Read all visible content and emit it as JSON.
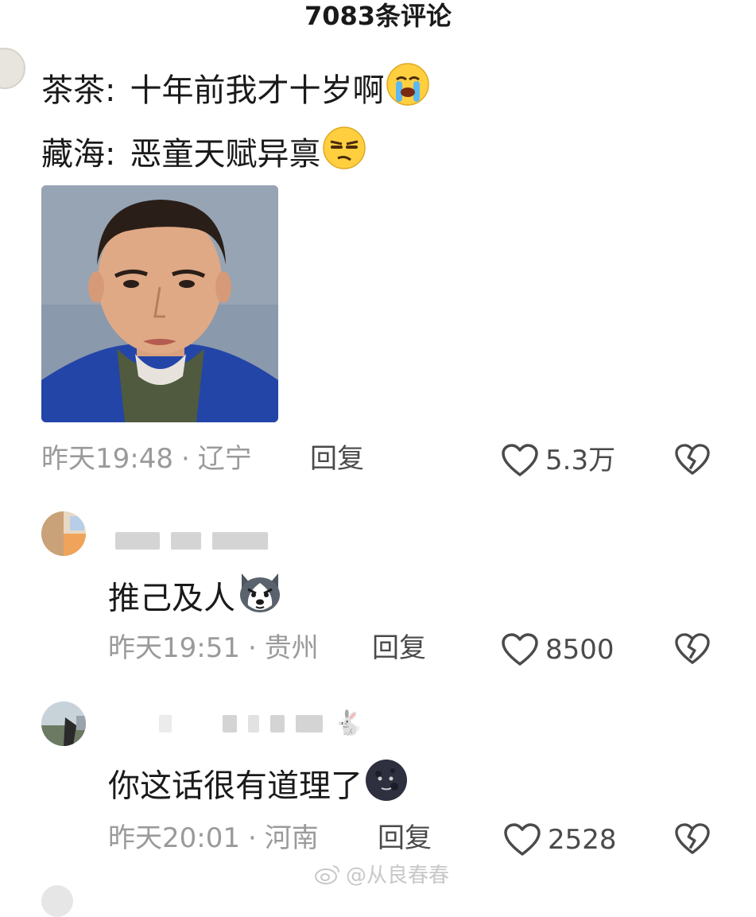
{
  "header": {
    "title": "7083条评论"
  },
  "main_comment": {
    "lines": [
      {
        "speaker": "茶茶:",
        "text": "十年前我才十岁啊",
        "emoji": "crying-face"
      },
      {
        "speaker": "藏海:",
        "text": "恶童天赋异禀",
        "emoji": "smirking-face"
      }
    ],
    "photo": "portrait-photo",
    "time": "昨天19:48",
    "location": "辽宁",
    "reply_label": "回复",
    "likes": "5.3万"
  },
  "replies": [
    {
      "text": "推己及人",
      "emoji": "husky-dog-face",
      "time": "昨天19:51",
      "location": "贵州",
      "reply_label": "回复",
      "likes": "8500"
    },
    {
      "text": "你这话很有道理了",
      "emoji": "new-moon-face",
      "time": "昨天20:01",
      "location": "河南",
      "reply_label": "回复",
      "likes": "2528"
    }
  ],
  "meta_separator": "·",
  "watermark": {
    "text": "@从良春春",
    "icon": "weibo-icon"
  },
  "colors": {
    "text": "#1a1a1a",
    "meta": "#9a9a9a",
    "action": "#4a4a4a"
  }
}
